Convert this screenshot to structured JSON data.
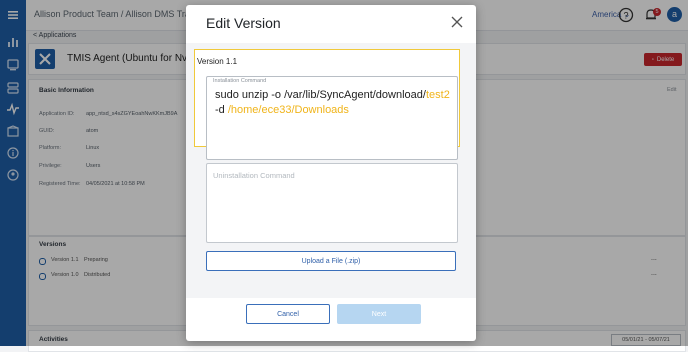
{
  "topbar": {
    "breadcrumb": "Allison Product Team /  Allison DMS Trainin",
    "region": "America",
    "notification_count": "5",
    "avatar_initial": "a"
  },
  "subnav": {
    "back_link": "< Applications"
  },
  "app": {
    "name": "TMIS Agent (Ubuntu for Nvi",
    "delete_label": "Delete",
    "basic_info_title": "Basic Information",
    "edit_label": "Edit",
    "fields": [
      {
        "label": "Application ID:",
        "value": "app_ntsd_s4sZGYEoahNwKKmJB9A"
      },
      {
        "label": "GUID:",
        "value": "atom"
      },
      {
        "label": "Platform:",
        "value": "Linux"
      },
      {
        "label": "Privilege:",
        "value": "Users"
      },
      {
        "label": "Registered Time:",
        "value": "04/05/2021 at 10:58 PM"
      }
    ],
    "versions_title": "Versions",
    "versions": [
      {
        "name": "Version 1.1",
        "status": "Preparing",
        "more": "..."
      },
      {
        "name": "Version 1.0",
        "status": "Distributed",
        "more": "..."
      }
    ],
    "activities_title": "Activities",
    "date_range": "05/01/21 - 05/07/21"
  },
  "modal": {
    "title": "Edit Version",
    "version_label": "Version 1.1",
    "install_label": "Installation Command",
    "install_parts": {
      "p1": "sudo unzip -o /var/lib/SyncAgent/download/",
      "p2": "test2",
      "p3": " -d ",
      "p4": "/home/ece33/Downloads"
    },
    "uninstall_placeholder": "Uninstallation Command",
    "upload_label": "Upload a File (.zip)",
    "cancel_label": "Cancel",
    "next_label": "Next"
  },
  "colors": {
    "sidebar": "#1f5fa8",
    "highlight": "#f0b41a",
    "primary": "#3a6fba",
    "danger": "#c8262d"
  }
}
